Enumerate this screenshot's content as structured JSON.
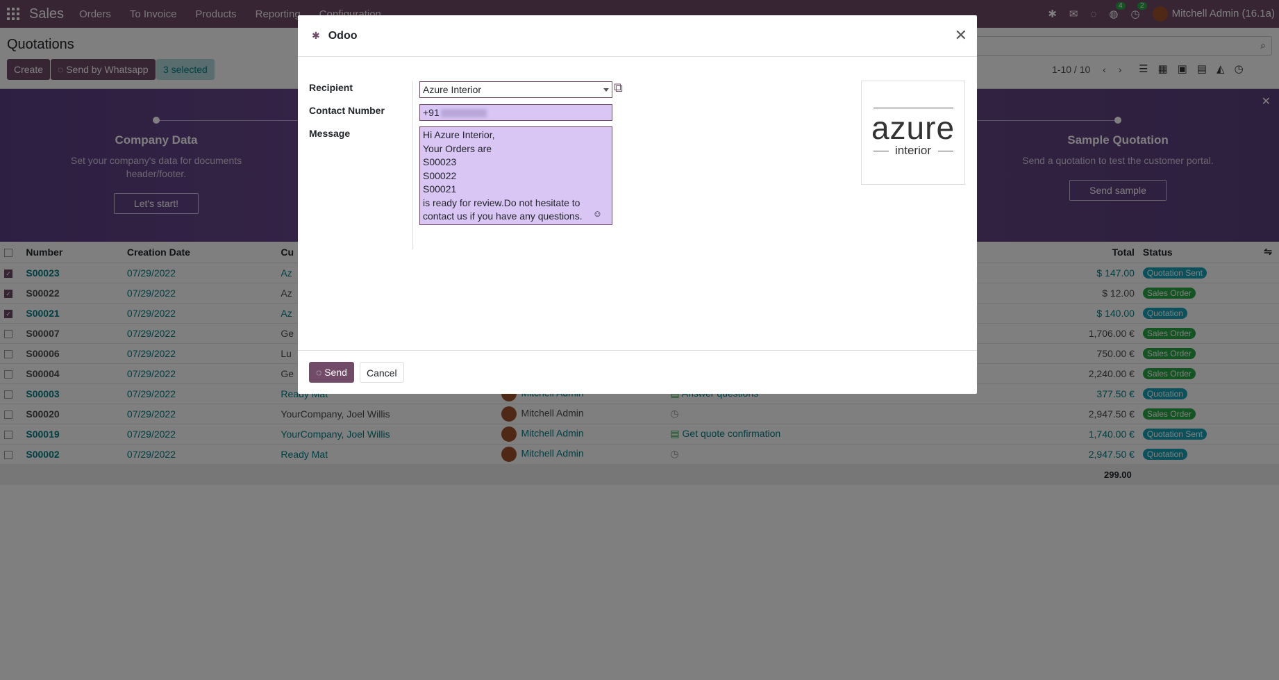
{
  "topbar": {
    "brand": "Sales",
    "menu": [
      "Orders",
      "To Invoice",
      "Products",
      "Reporting",
      "Configuration"
    ],
    "chat_badge": "4",
    "activity_badge": "2",
    "user": "Mitchell Admin (16.1a)"
  },
  "control": {
    "title": "Quotations",
    "create": "Create",
    "send_whatsapp": "Send by Whatsapp",
    "selected": "3 selected",
    "pager": "1-10 / 10"
  },
  "banner": {
    "left": {
      "title": "Company Data",
      "text": "Set your company's data for documents header/footer.",
      "button": "Let's start!"
    },
    "right": {
      "title": "Sample Quotation",
      "text": "Send a quotation to test the customer portal.",
      "button": "Send sample"
    }
  },
  "table": {
    "headers": {
      "number": "Number",
      "date": "Creation Date",
      "customer": "Cu",
      "total": "Total",
      "status": "Status"
    },
    "rows": [
      {
        "number": "S00023",
        "date": "07/29/2022",
        "customer": "Az",
        "sales": "",
        "activity": "",
        "total": "$ 147.00",
        "status": "Quotation Sent",
        "checked": true
      },
      {
        "number": "S00022",
        "date": "07/29/2022",
        "customer": "Az",
        "sales": "",
        "activity": "",
        "total": "$ 12.00",
        "status": "Sales Order",
        "checked": true
      },
      {
        "number": "S00021",
        "date": "07/29/2022",
        "customer": "Az",
        "sales": "",
        "activity": "",
        "total": "$ 140.00",
        "status": "Quotation",
        "checked": true
      },
      {
        "number": "S00007",
        "date": "07/29/2022",
        "customer": "Ge",
        "sales": "",
        "activity": "",
        "total": "1,706.00 €",
        "status": "Sales Order",
        "checked": false
      },
      {
        "number": "S00006",
        "date": "07/29/2022",
        "customer": "Lu",
        "sales": "",
        "activity": "",
        "total": "750.00 €",
        "status": "Sales Order",
        "checked": false
      },
      {
        "number": "S00004",
        "date": "07/29/2022",
        "customer": "Ge",
        "sales": "",
        "activity": "",
        "total": "2,240.00 €",
        "status": "Sales Order",
        "checked": false
      },
      {
        "number": "S00003",
        "date": "07/29/2022",
        "customer": "Ready Mat",
        "sales": "Mitchell Admin",
        "activity": "Answer questions",
        "total": "377.50 €",
        "status": "Quotation",
        "checked": false
      },
      {
        "number": "S00020",
        "date": "07/29/2022",
        "customer": "YourCompany, Joel Willis",
        "sales": "Mitchell Admin",
        "activity": "",
        "total": "2,947.50 €",
        "status": "Sales Order",
        "checked": false
      },
      {
        "number": "S00019",
        "date": "07/29/2022",
        "customer": "YourCompany, Joel Willis",
        "sales": "Mitchell Admin",
        "activity": "Get quote confirmation",
        "total": "1,740.00 €",
        "status": "Quotation Sent",
        "checked": false
      },
      {
        "number": "S00002",
        "date": "07/29/2022",
        "customer": "Ready Mat",
        "sales": "Mitchell Admin",
        "activity": "",
        "total": "2,947.50 €",
        "status": "Quotation",
        "checked": false
      }
    ],
    "grand_total": "299.00"
  },
  "modal": {
    "title": "Odoo",
    "recipient_label": "Recipient",
    "recipient": "Azure Interior",
    "contact_label": "Contact Number",
    "contact_prefix": "+91",
    "message_label": "Message",
    "message_lines": [
      "Hi Azure Interior,",
      "Your Orders are",
      "S00023",
      "S00022",
      "S00021",
      "is ready for review.Do not hesitate to contact us if you have any questions."
    ],
    "logo_main": "azure",
    "logo_sub": "interior",
    "send": "Send",
    "cancel": "Cancel"
  }
}
